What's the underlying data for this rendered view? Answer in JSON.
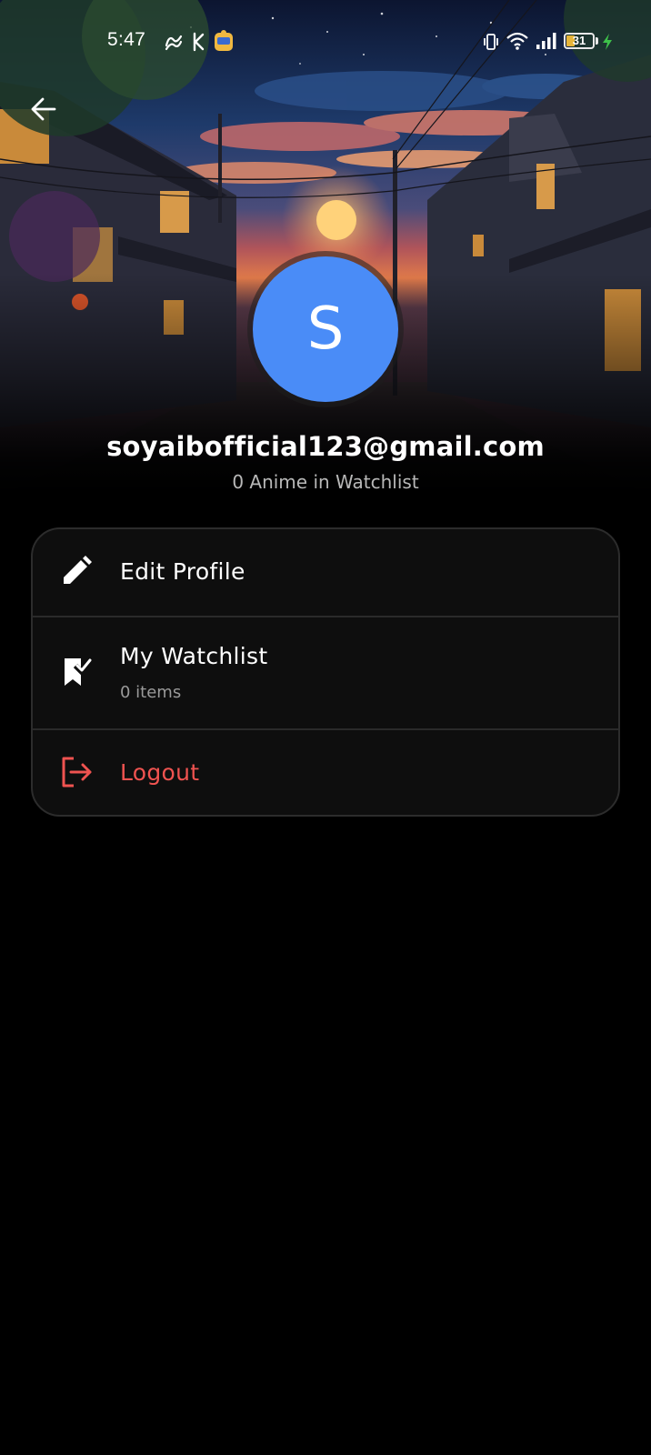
{
  "status_bar": {
    "time": "5:47",
    "battery_level": "31"
  },
  "profile": {
    "avatar_initial": "S",
    "email": "soyaibofficial123@gmail.com",
    "watchlist_summary": "0 Anime in Watchlist"
  },
  "menu": {
    "edit_profile_label": "Edit Profile",
    "watchlist_label": "My Watchlist",
    "watchlist_sub": "0 items",
    "logout_label": "Logout"
  },
  "colors": {
    "avatar_bg": "#4a8cf7",
    "logout": "#ef5350",
    "card_bg": "#0e0e0e",
    "background": "#000000"
  }
}
